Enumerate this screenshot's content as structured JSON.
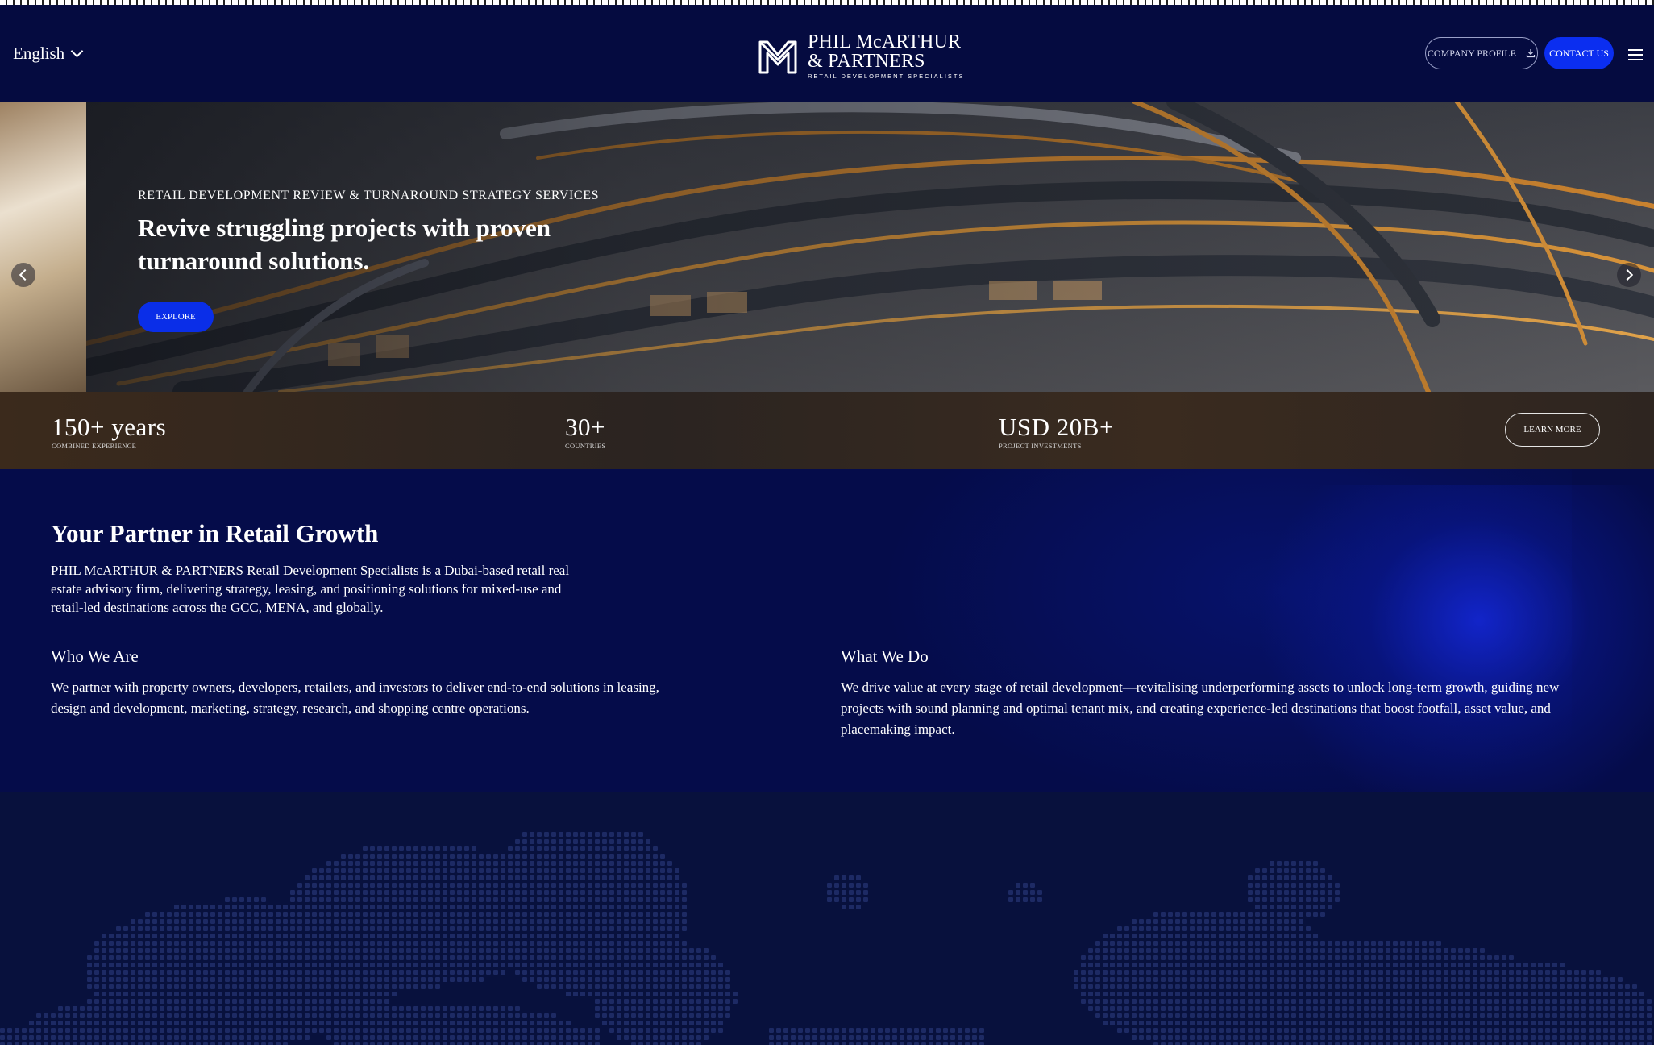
{
  "header": {
    "language": "English",
    "logo": {
      "line1": "PHIL McARTHUR",
      "line2": "& PARTNERS",
      "line3": "RETAIL DEVELOPMENT SPECIALISTS"
    },
    "company_profile_label": "COMPANY PROFILE",
    "contact_label": "CONTACT US"
  },
  "hero": {
    "kicker": "RETAIL DEVELOPMENT REVIEW & TURNAROUND STRATEGY SERVICES",
    "title": "Revive struggling projects with proven turnaround solutions.",
    "explore_label": "EXPLORE",
    "learn_more_label": "LEARN MORE",
    "stats": [
      {
        "value": "150+ years",
        "label": "COMBINED EXPERIENCE"
      },
      {
        "value": "30+",
        "label": "COUNTRIES"
      },
      {
        "value": "USD 20B+",
        "label": "PROJECT INVESTMENTS"
      }
    ]
  },
  "about": {
    "title": "Your Partner in Retail Growth",
    "body": "PHIL McARTHUR & PARTNERS Retail Development Specialists is a Dubai-based retail real estate advisory firm, delivering strategy, leasing, and positioning solutions for mixed-use and retail-led destinations across the GCC, MENA, and globally.",
    "who": {
      "title": "Who We Are",
      "body": "We partner with property owners, developers, retailers, and investors to deliver end-to-end solutions in leasing, design and development, marketing, strategy, research, and shopping centre operations."
    },
    "what": {
      "title": "What We Do",
      "body": "We drive value at every stage of retail development—revitalising underperforming assets to unlock long-term growth, guiding new projects with sound planning and optimal tenant mix, and creating experience-led destinations that boost footfall, asset value, and placemaking impact."
    }
  },
  "colors": {
    "navy": "#050b40",
    "accent_blue": "#0b2ef0",
    "map_dots": "#1d2a64"
  },
  "icons": {
    "language_toggle": "chevron-down-icon",
    "download": "download-icon",
    "menu": "hamburger-menu-icon",
    "prev": "chevron-left-icon",
    "next": "chevron-right-icon"
  }
}
